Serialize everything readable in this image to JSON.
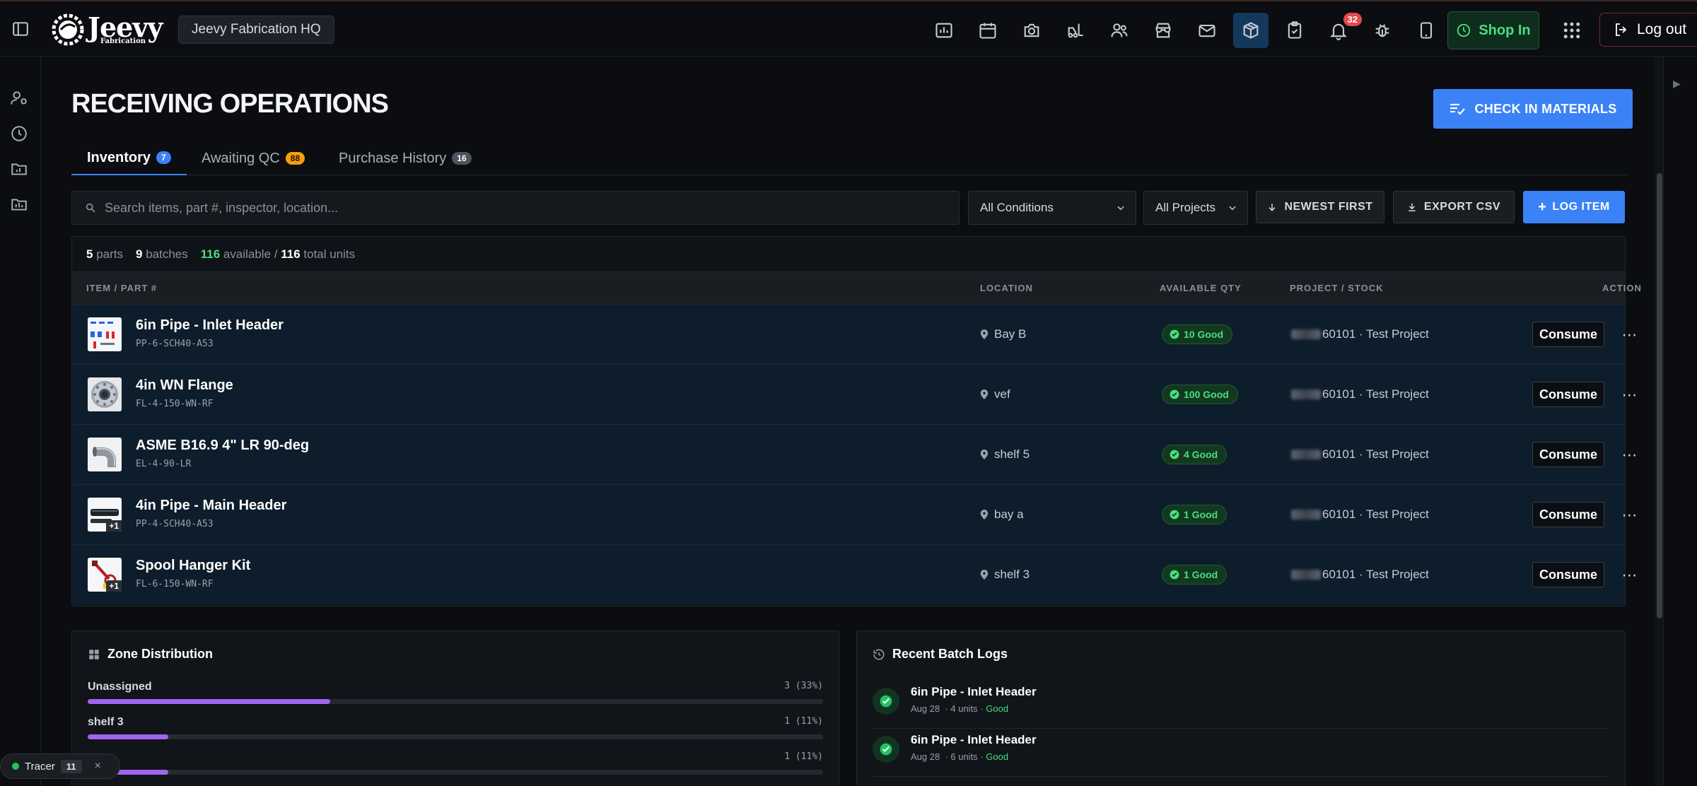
{
  "header": {
    "logo_big": "Jeevy",
    "logo_small": "Fabrication",
    "org_name": "Jeevy Fabrication HQ",
    "nav_icons": [
      "dashboard-icon",
      "calendar-icon",
      "camera-icon",
      "forklift-icon",
      "users-icon",
      "store-icon",
      "mail-icon",
      "package-icon",
      "clipboard-check-icon",
      "bell-icon",
      "bug-icon",
      "tablet-icon"
    ],
    "notification_count": "32",
    "shop_in_label": "Shop In",
    "logout_label": "Log out"
  },
  "page": {
    "title": "RECEIVING OPERATIONS",
    "checkin_label": "CHECK IN MATERIALS"
  },
  "tabs": [
    {
      "label": "Inventory",
      "count": "7"
    },
    {
      "label": "Awaiting QC",
      "count": "88"
    },
    {
      "label": "Purchase History",
      "count": "16"
    }
  ],
  "filters": {
    "search_placeholder": "Search items, part #, inspector, location...",
    "conditions": "All Conditions",
    "projects": "All Projects",
    "sort_label": "NEWEST FIRST",
    "export_label": "EXPORT CSV",
    "log_label": "LOG ITEM"
  },
  "summary": {
    "parts": "5",
    "parts_label": "parts",
    "batches": "9",
    "batches_label": "batches",
    "available": "116",
    "available_label": "available /",
    "total": "116",
    "total_label": "total units"
  },
  "columns": {
    "item": "ITEM / PART #",
    "location": "LOCATION",
    "qty": "AVAILABLE QTY",
    "project": "PROJECT / STOCK",
    "action": "ACTION"
  },
  "rows": [
    {
      "name": "6in Pipe - Inlet Header",
      "part": "PP-6-SCH40-A53",
      "location": "Bay B",
      "qty": "10 Good",
      "project": "60101 · Test Project",
      "action": "Consume",
      "extra": ""
    },
    {
      "name": "4in WN Flange",
      "part": "FL-4-150-WN-RF",
      "location": "vef",
      "qty": "100 Good",
      "project": "60101 · Test Project",
      "action": "Consume",
      "extra": ""
    },
    {
      "name": "ASME B16.9 4\" LR 90-deg",
      "part": "EL-4-90-LR",
      "location": "shelf 5",
      "qty": "4 Good",
      "project": "60101 · Test Project",
      "action": "Consume",
      "extra": ""
    },
    {
      "name": "4in Pipe - Main Header",
      "part": "PP-4-SCH40-A53",
      "location": "bay a",
      "qty": "1 Good",
      "project": "60101 · Test Project",
      "action": "Consume",
      "extra": "+1"
    },
    {
      "name": "Spool Hanger Kit",
      "part": "FL-6-150-WN-RF",
      "location": "shelf 3",
      "qty": "1 Good",
      "project": "60101 · Test Project",
      "action": "Consume",
      "extra": "+1"
    }
  ],
  "zone_panel": {
    "title": "Zone Distribution",
    "zones": [
      {
        "name": "Unassigned",
        "count": "3 (33%)",
        "fraction": 0.33
      },
      {
        "name": "shelf 3",
        "count": "1 (11%)",
        "fraction": 0.11
      },
      {
        "name": "",
        "count": "1 (11%)",
        "fraction": 0.11
      }
    ]
  },
  "logs_panel": {
    "title": "Recent Batch Logs",
    "logs": [
      {
        "title": "6in Pipe - Inlet Header",
        "date": "Aug 28",
        "units": "· 4 units",
        "status": "· Good"
      },
      {
        "title": "6in Pipe - Inlet Header",
        "date": "Aug 28",
        "units": "· 6 units",
        "status": "· Good"
      }
    ]
  },
  "tracer": {
    "label": "Tracer",
    "count": "11",
    "close": "×"
  },
  "colors": {
    "accent": "#3b82f6",
    "good": "#4ade80",
    "zone_bar": "#a064f0",
    "alert": "#e5484d"
  }
}
